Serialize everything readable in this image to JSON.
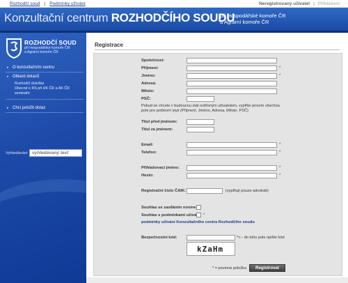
{
  "topbar": {
    "links": [
      "Rozhodčí soud",
      "Podmínky užívání"
    ],
    "user_status": "Neregistrovaný uživatel",
    "logout": "Přihlášení"
  },
  "banner": {
    "title_thin": "Konzultační centrum ",
    "title_bold": "ROZHODČÍHO SOUDU",
    "subtitle_line1": "při Hospodářské komoře ČR",
    "subtitle_line2": "a Agrární komoře ČR"
  },
  "logo": {
    "title": "ROZHODČÍ SOUD",
    "sub_line1": "při Hospodářské komoře ČR",
    "sub_line2": "a Agrární komoře ČR"
  },
  "sidebar": {
    "items": [
      {
        "label": "O konzultačním centru"
      },
      {
        "label": "Oblasti dotazů",
        "subitems": [
          "Rozhodčí doložka",
          "Obecně o RS při HK ČR a AK ČR",
          "semináře"
        ]
      },
      {
        "label": "Chci položit dotaz"
      }
    ],
    "search_label": "Vyhledávání",
    "search_placeholder": "vyhledávaný text"
  },
  "form": {
    "title": "Registrace",
    "fields": {
      "company": "Společnost:",
      "surname": "Příjmení:",
      "name": "Jméno:",
      "address": "Adresa:",
      "city": "Město:",
      "zip": "PSČ:",
      "title_before": "Titul před jménem:",
      "title_after": "Titul za jménem:",
      "email": "Email:",
      "phone": "Telefon:",
      "login": "Přihlašovací jméno:",
      "password": "Heslo:",
      "caik": "Registrační číslo ČAIK:",
      "security": "Bezpečnostní kód:"
    },
    "verify_note": "Pokud se chcete v budoucnu stát ověřeným uživatelem, vyplňte prosím všechna pole pro poštovní styk (Příjmení, Jméno, Adresa, Město, PSČ)",
    "caik_note": "(vyplňují pouze advokáti)",
    "news_consent": "Souhlas se zasíláním novinek:",
    "terms_consent": "Souhlas s podmínkami užívání:",
    "terms_link": "podmínky užívání Konzultačního centra Rozhodčího soudu",
    "captcha_text": "kZaHm",
    "captcha_hint": "*<-- do toho pole opište kód",
    "required_note": "* = povinná položka",
    "submit": "Registrovat",
    "star": "*"
  }
}
